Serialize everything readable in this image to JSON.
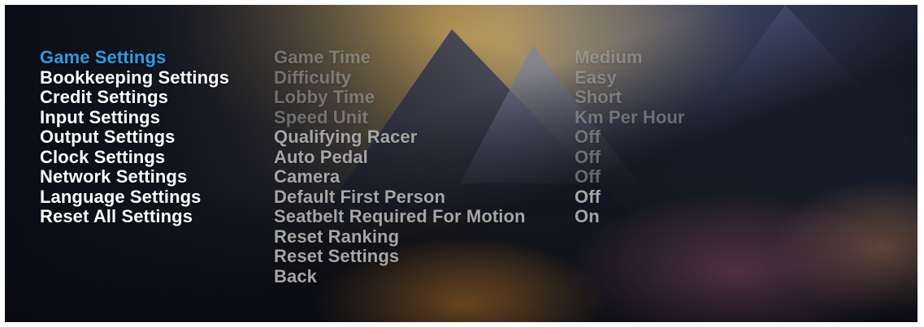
{
  "categories": [
    {
      "label": "Game Settings",
      "selected": true
    },
    {
      "label": "Bookkeeping Settings",
      "selected": false
    },
    {
      "label": "Credit Settings",
      "selected": false
    },
    {
      "label": "Input Settings",
      "selected": false
    },
    {
      "label": "Output Settings",
      "selected": false
    },
    {
      "label": "Clock Settings",
      "selected": false
    },
    {
      "label": "Network Settings",
      "selected": false
    },
    {
      "label": "Language Settings",
      "selected": false
    },
    {
      "label": "Reset All Settings",
      "selected": false
    }
  ],
  "options": [
    {
      "label": "Game Time",
      "value": "Medium"
    },
    {
      "label": "Difficulty",
      "value": "Easy"
    },
    {
      "label": "Lobby Time",
      "value": "Short"
    },
    {
      "label": "Speed Unit",
      "value": "Km Per Hour"
    },
    {
      "label": "Qualifying Racer",
      "value": "Off"
    },
    {
      "label": "Auto Pedal",
      "value": "Off"
    },
    {
      "label": "Camera",
      "value": "Off"
    },
    {
      "label": "Default First Person",
      "value": "Off"
    },
    {
      "label": "Seatbelt Required For Motion",
      "value": "On"
    },
    {
      "label": "Reset Ranking"
    },
    {
      "label": "Reset Settings"
    },
    {
      "label": "Back"
    }
  ],
  "colors": {
    "selected_category": "#2f9be6",
    "category_text": "#ffffff",
    "option_text": "#a6a6a6"
  }
}
